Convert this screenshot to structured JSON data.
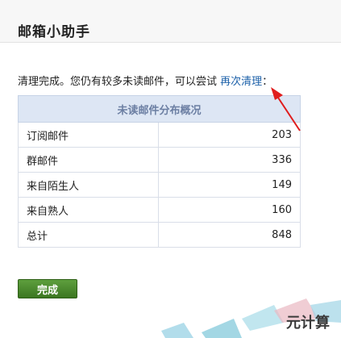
{
  "dialog": {
    "title": "邮箱小助手"
  },
  "message": {
    "prefix": "清理完成。您仍有较多未读邮件，可以尝试 ",
    "link": "再次清理",
    "suffix": "："
  },
  "table": {
    "header": "未读邮件分布概况",
    "rows": [
      {
        "label": "订阅邮件",
        "value": "203"
      },
      {
        "label": "群邮件",
        "value": "336"
      },
      {
        "label": "来自陌生人",
        "value": "149"
      },
      {
        "label": "来自熟人",
        "value": "160"
      },
      {
        "label": "总计",
        "value": "848"
      }
    ]
  },
  "done_button": "完成",
  "watermark": {
    "text": "元计算"
  },
  "colors": {
    "header_bg": "#dde6f4",
    "button": "#4a8a2e",
    "arrow": "#e01d1d",
    "link": "#1a5fa8"
  }
}
